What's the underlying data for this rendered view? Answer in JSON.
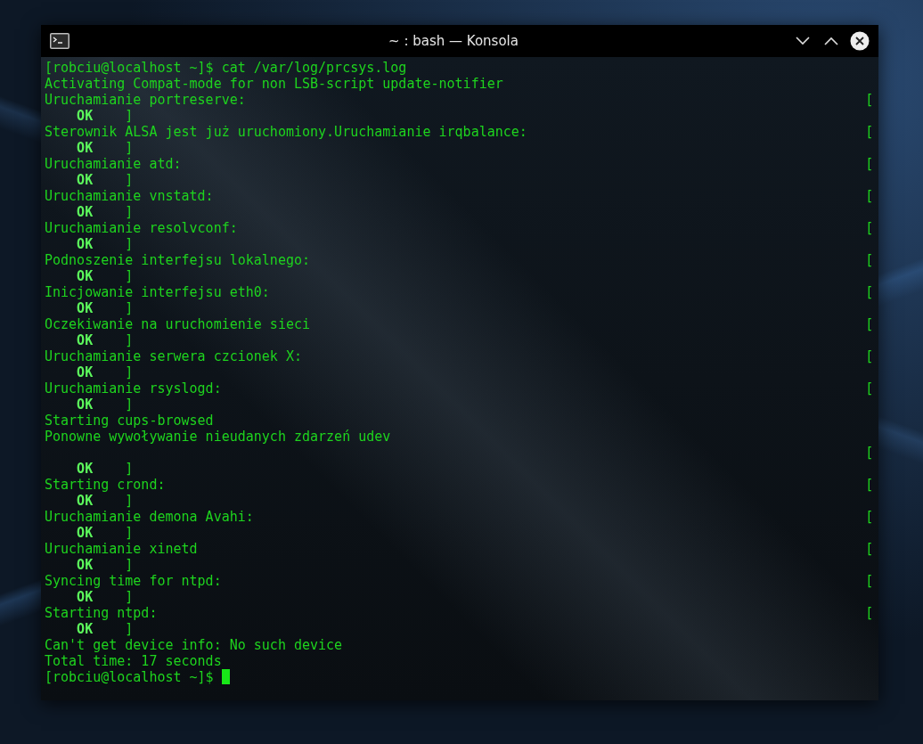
{
  "window": {
    "title": "~ : bash — Konsola"
  },
  "terminal": {
    "lines": [
      {
        "kind": "prompt",
        "text": "[robciu@localhost ~]$ cat /var/log/prcsys.log",
        "cursor": false
      },
      {
        "kind": "text",
        "text": "Activating Compat-mode for non LSB-script update-notifier"
      },
      {
        "kind": "pending",
        "text": "Uruchamianie portreserve:",
        "bracket": "["
      },
      {
        "kind": "result",
        "status": "OK",
        "bracket": "]"
      },
      {
        "kind": "pending",
        "text": "Sterownik ALSA jest już uruchomiony.Uruchamianie irqbalance:",
        "bracket": "["
      },
      {
        "kind": "result",
        "status": "OK",
        "bracket": "]"
      },
      {
        "kind": "pending",
        "text": "Uruchamianie atd:",
        "bracket": "["
      },
      {
        "kind": "result",
        "status": "OK",
        "bracket": "]"
      },
      {
        "kind": "pending",
        "text": "Uruchamianie vnstatd:",
        "bracket": "["
      },
      {
        "kind": "result",
        "status": "OK",
        "bracket": "]"
      },
      {
        "kind": "pending",
        "text": "Uruchamianie resolvconf:",
        "bracket": "["
      },
      {
        "kind": "result",
        "status": "OK",
        "bracket": "]"
      },
      {
        "kind": "pending",
        "text": "Podnoszenie interfejsu lokalnego:",
        "bracket": "["
      },
      {
        "kind": "result",
        "status": "OK",
        "bracket": "]"
      },
      {
        "kind": "pending",
        "text": "Inicjowanie interfejsu eth0:",
        "bracket": "["
      },
      {
        "kind": "result",
        "status": "OK",
        "bracket": "]"
      },
      {
        "kind": "pending",
        "text": "Oczekiwanie na uruchomienie sieci",
        "bracket": "["
      },
      {
        "kind": "result",
        "status": "OK",
        "bracket": "]"
      },
      {
        "kind": "pending",
        "text": "Uruchamianie serwera czcionek X:",
        "bracket": "["
      },
      {
        "kind": "result",
        "status": "OK",
        "bracket": "]"
      },
      {
        "kind": "pending",
        "text": "Uruchamianie rsyslogd:",
        "bracket": "["
      },
      {
        "kind": "result",
        "status": "OK",
        "bracket": "]"
      },
      {
        "kind": "text",
        "text": "Starting cups-browsed"
      },
      {
        "kind": "text",
        "text": "Ponowne wywoływanie nieudanych zdarzeń udev"
      },
      {
        "kind": "pending",
        "bracket": "["
      },
      {
        "kind": "result",
        "status": "OK",
        "bracket": "]"
      },
      {
        "kind": "pending",
        "text": "Starting crond:",
        "bracket": "["
      },
      {
        "kind": "result",
        "status": "OK",
        "bracket": "]"
      },
      {
        "kind": "pending",
        "text": "Uruchamianie demona Avahi:",
        "bracket": "["
      },
      {
        "kind": "result",
        "status": "OK",
        "bracket": "]"
      },
      {
        "kind": "pending",
        "text": "Uruchamianie xinetd",
        "bracket": "["
      },
      {
        "kind": "result",
        "status": "OK",
        "bracket": "]"
      },
      {
        "kind": "pending",
        "text": "Syncing time for ntpd:",
        "bracket": "["
      },
      {
        "kind": "result",
        "status": "OK",
        "bracket": "]"
      },
      {
        "kind": "pending",
        "text": "Starting ntpd:",
        "bracket": "["
      },
      {
        "kind": "result",
        "status": "OK",
        "bracket": "]"
      },
      {
        "kind": "text",
        "text": "Can't get device info: No such device"
      },
      {
        "kind": "text",
        "text": "Total time: 17 seconds"
      },
      {
        "kind": "prompt",
        "text": "[robciu@localhost ~]$",
        "cursor": true
      }
    ]
  }
}
